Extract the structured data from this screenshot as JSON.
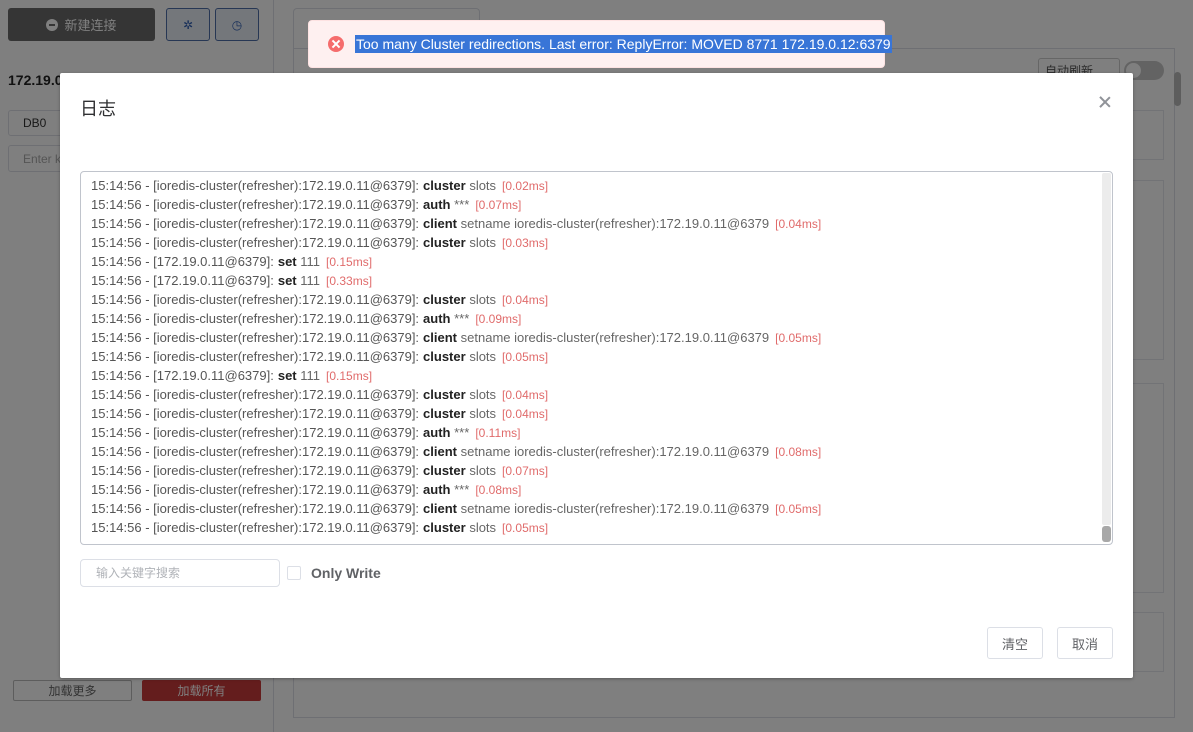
{
  "sidebar": {
    "new_connection_label": "新建连接",
    "host": "172.19.0",
    "db_select": "DB0",
    "key_filter_placeholder": "Enter k",
    "load_more_label": "加载更多",
    "load_all_label": "加载所有"
  },
  "main": {
    "auto_refresh_label": "自动刷新"
  },
  "toast": {
    "type": "error",
    "message": "Too many Cluster redirections. Last error: ReplyError: MOVED 8771 172.19.0.12:6379"
  },
  "dialog": {
    "title": "日志",
    "logs": [
      {
        "time": "15:14:56",
        "source": "[ioredis-cluster(refresher):172.19.0.11@6379]:",
        "cmd": "cluster",
        "args": "slots",
        "duration": "[0.02ms]"
      },
      {
        "time": "15:14:56",
        "source": "[ioredis-cluster(refresher):172.19.0.11@6379]:",
        "cmd": "auth",
        "args": "***",
        "duration": "[0.07ms]"
      },
      {
        "time": "15:14:56",
        "source": "[ioredis-cluster(refresher):172.19.0.11@6379]:",
        "cmd": "client",
        "args": "setname ioredis-cluster(refresher):172.19.0.11@6379",
        "duration": "[0.04ms]"
      },
      {
        "time": "15:14:56",
        "source": "[ioredis-cluster(refresher):172.19.0.11@6379]:",
        "cmd": "cluster",
        "args": "slots",
        "duration": "[0.03ms]"
      },
      {
        "time": "15:14:56",
        "source": "[172.19.0.11@6379]:",
        "cmd": "set",
        "args": "111",
        "duration": "[0.15ms]"
      },
      {
        "time": "15:14:56",
        "source": "[172.19.0.11@6379]:",
        "cmd": "set",
        "args": "111",
        "duration": "[0.33ms]"
      },
      {
        "time": "15:14:56",
        "source": "[ioredis-cluster(refresher):172.19.0.11@6379]:",
        "cmd": "cluster",
        "args": "slots",
        "duration": "[0.04ms]"
      },
      {
        "time": "15:14:56",
        "source": "[ioredis-cluster(refresher):172.19.0.11@6379]:",
        "cmd": "auth",
        "args": "***",
        "duration": "[0.09ms]"
      },
      {
        "time": "15:14:56",
        "source": "[ioredis-cluster(refresher):172.19.0.11@6379]:",
        "cmd": "client",
        "args": "setname ioredis-cluster(refresher):172.19.0.11@6379",
        "duration": "[0.05ms]"
      },
      {
        "time": "15:14:56",
        "source": "[ioredis-cluster(refresher):172.19.0.11@6379]:",
        "cmd": "cluster",
        "args": "slots",
        "duration": "[0.05ms]"
      },
      {
        "time": "15:14:56",
        "source": "[172.19.0.11@6379]:",
        "cmd": "set",
        "args": "111",
        "duration": "[0.15ms]"
      },
      {
        "time": "15:14:56",
        "source": "[ioredis-cluster(refresher):172.19.0.11@6379]:",
        "cmd": "cluster",
        "args": "slots",
        "duration": "[0.04ms]"
      },
      {
        "time": "15:14:56",
        "source": "[ioredis-cluster(refresher):172.19.0.11@6379]:",
        "cmd": "cluster",
        "args": "slots",
        "duration": "[0.04ms]"
      },
      {
        "time": "15:14:56",
        "source": "[ioredis-cluster(refresher):172.19.0.11@6379]:",
        "cmd": "auth",
        "args": "***",
        "duration": "[0.11ms]"
      },
      {
        "time": "15:14:56",
        "source": "[ioredis-cluster(refresher):172.19.0.11@6379]:",
        "cmd": "client",
        "args": "setname ioredis-cluster(refresher):172.19.0.11@6379",
        "duration": "[0.08ms]"
      },
      {
        "time": "15:14:56",
        "source": "[ioredis-cluster(refresher):172.19.0.11@6379]:",
        "cmd": "cluster",
        "args": "slots",
        "duration": "[0.07ms]"
      },
      {
        "time": "15:14:56",
        "source": "[ioredis-cluster(refresher):172.19.0.11@6379]:",
        "cmd": "auth",
        "args": "***",
        "duration": "[0.08ms]"
      },
      {
        "time": "15:14:56",
        "source": "[ioredis-cluster(refresher):172.19.0.11@6379]:",
        "cmd": "client",
        "args": "setname ioredis-cluster(refresher):172.19.0.11@6379",
        "duration": "[0.05ms]"
      },
      {
        "time": "15:14:56",
        "source": "[ioredis-cluster(refresher):172.19.0.11@6379]:",
        "cmd": "cluster",
        "args": "slots",
        "duration": "[0.05ms]"
      }
    ],
    "search_placeholder": "输入关键字搜索",
    "only_write_label": "Only Write",
    "only_write_checked": false,
    "clear_label": "清空",
    "cancel_label": "取消"
  },
  "colors": {
    "toast_bg": "#fef0f0",
    "error_icon": "#f56c6c",
    "duration_text": "#e06b6b",
    "load_all_button": "#c93a3a"
  }
}
